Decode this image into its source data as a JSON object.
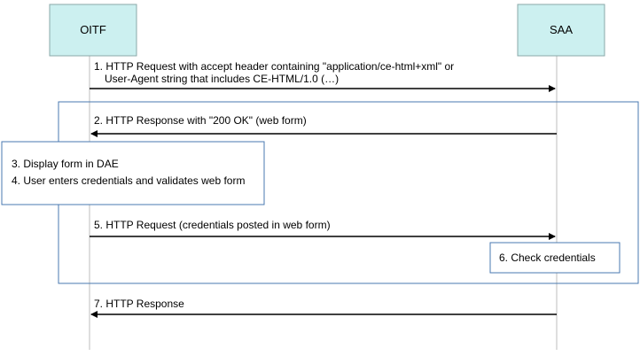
{
  "participants": {
    "oitf": "OITF",
    "saa": "SAA"
  },
  "messages": {
    "m1_line1": "1. HTTP Request with accept header containing \"application/ce-html+xml\" or",
    "m1_line2": "User-Agent string that includes CE-HTML/1.0 (…)",
    "m2": "2. HTTP Response with \"200 OK\" (web form)",
    "m5": "5. HTTP Request (credentials posted in web form)",
    "m7": "7. HTTP Response"
  },
  "notes": {
    "n3": "3. Display form in DAE",
    "n4": "4. User enters credentials and validates web form",
    "n6": "6. Check credentials"
  }
}
